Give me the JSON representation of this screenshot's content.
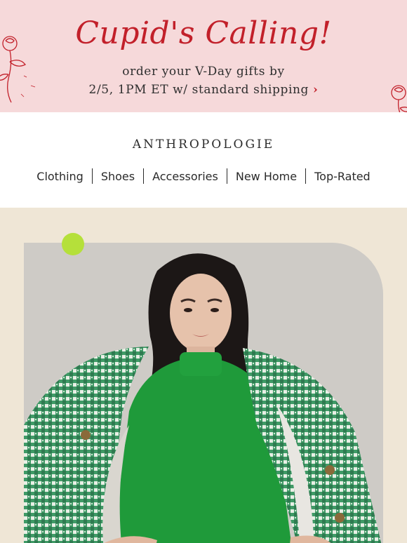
{
  "promo": {
    "headline": "Cupid's Calling!",
    "line1": "order your V-Day gifts by",
    "line2": "2/5, 1PM ET w/ standard shipping",
    "chevron": "›",
    "colors": {
      "background": "#f6d9da",
      "accent": "#c2202a"
    }
  },
  "brand": {
    "name": "ANTHROPOLOGIE"
  },
  "nav": {
    "items": [
      {
        "label": "Clothing"
      },
      {
        "label": "Shoes"
      },
      {
        "label": "Accessories"
      },
      {
        "label": "New Home"
      },
      {
        "label": "Top-Rated"
      }
    ]
  },
  "hero": {
    "background": "#efe6d6",
    "accent_dot": "#b5e03a",
    "image": "model-in-green-sweater-and-tweed-jacket"
  }
}
